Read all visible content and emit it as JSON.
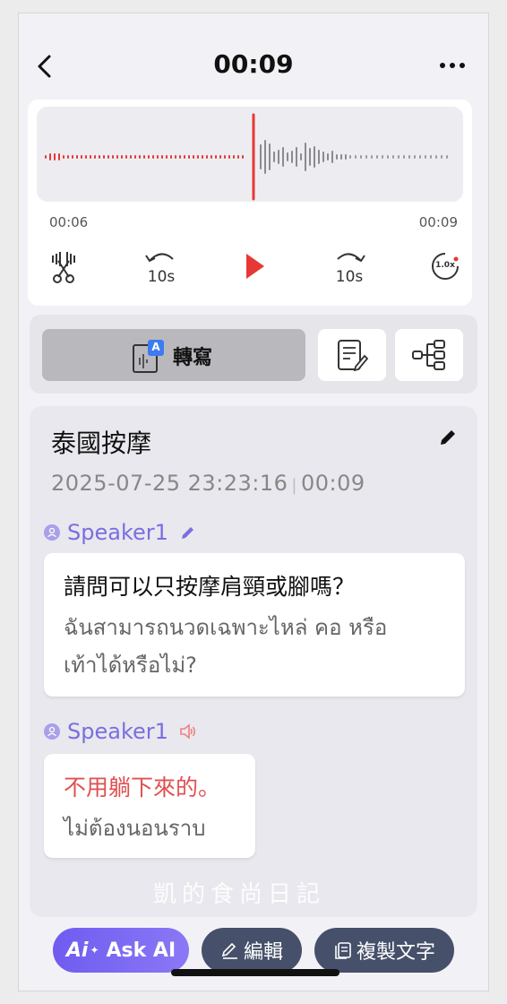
{
  "header": {
    "title": "00:09"
  },
  "player": {
    "time_start": "00:06",
    "time_end": "00:09",
    "rewind_label": "10s",
    "forward_label": "10s",
    "speed_label": "1.0x",
    "accent": "#e53935"
  },
  "tabs": {
    "transcribe_label": "轉寫",
    "transcribe_badge": "A"
  },
  "record": {
    "title": "泰國按摩",
    "datetime": "2025-07-25 23:23:16",
    "duration": "00:09"
  },
  "messages": [
    {
      "speaker": "Speaker1",
      "speaker_icon": "pencil-icon",
      "zh": "請問可以只按摩肩頸或腳嗎？",
      "th_line1": "ฉันสามารถนวดเฉพาะไหล่ คอ หรือ",
      "th_line2": "เท้าได้หรือไม่?"
    },
    {
      "speaker": "Speaker1",
      "speaker_icon": "speaker-icon",
      "zh": "不用躺下來的。",
      "th_line1": "ไม่ต้องนอนราบ"
    }
  ],
  "watermark": "凱的食尚日記",
  "bottom": {
    "ask_ai": "Ask AI",
    "ask_ai_badge": "Ai",
    "edit": "編輯",
    "copy": "複製文字"
  }
}
